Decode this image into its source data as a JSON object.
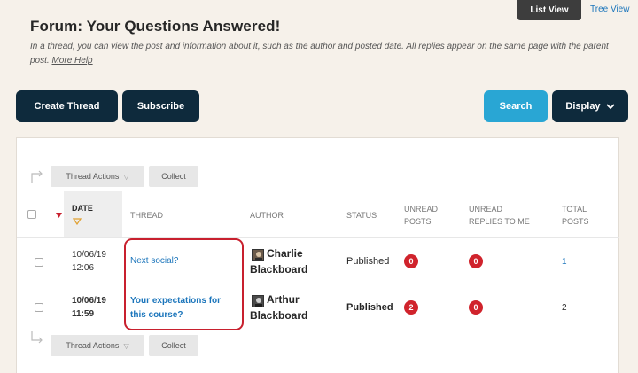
{
  "view_toggle": {
    "list_view": "List View",
    "tree_view": "Tree View"
  },
  "header": {
    "title": "Forum: Your Questions Answered!",
    "description": "In a thread, you can view the post and information about it, such as the author and posted date. All replies appear on the same page with the parent post.",
    "more_help": "More Help"
  },
  "toolbar": {
    "create_thread": "Create Thread",
    "subscribe": "Subscribe",
    "search": "Search",
    "display": "Display"
  },
  "actions": {
    "thread_actions": "Thread Actions",
    "collect": "Collect"
  },
  "table": {
    "headers": {
      "date": "DATE",
      "thread": "THREAD",
      "author": "AUTHOR",
      "status": "STATUS",
      "unread_posts_1": "UNREAD",
      "unread_posts_2": "POSTS",
      "unread_replies_1": "UNREAD",
      "unread_replies_2": "REPLIES TO ME",
      "total_posts_1": "TOTAL",
      "total_posts_2": "POSTS"
    },
    "rows": [
      {
        "date": "10/06/19",
        "time": "12:06",
        "thread_line1": "Next social?",
        "thread_line2": "",
        "author_line1": "Charlie",
        "author_line2": "Blackboard",
        "status": "Published",
        "unread_posts": "0",
        "unread_replies": "0",
        "total_posts": "1",
        "unread": false
      },
      {
        "date": "10/06/19",
        "time": "11:59",
        "thread_line1": "Your expectations for",
        "thread_line2": "this course?",
        "author_line1": "Arthur",
        "author_line2": "Blackboard",
        "status": "Published",
        "unread_posts": "2",
        "unread_replies": "0",
        "total_posts": "2",
        "unread": true
      }
    ]
  },
  "colors": {
    "background": "#f6f1ea",
    "dark_button": "#0e2a3c",
    "search_button": "#29a6d4",
    "link": "#1b75bb",
    "badge": "#d0232c",
    "highlight": "#c8202e"
  },
  "icons": [
    "chevron-down-icon",
    "sort-arrow-icon",
    "flag-icon",
    "elbow-arrow-icon",
    "avatar-icon"
  ]
}
